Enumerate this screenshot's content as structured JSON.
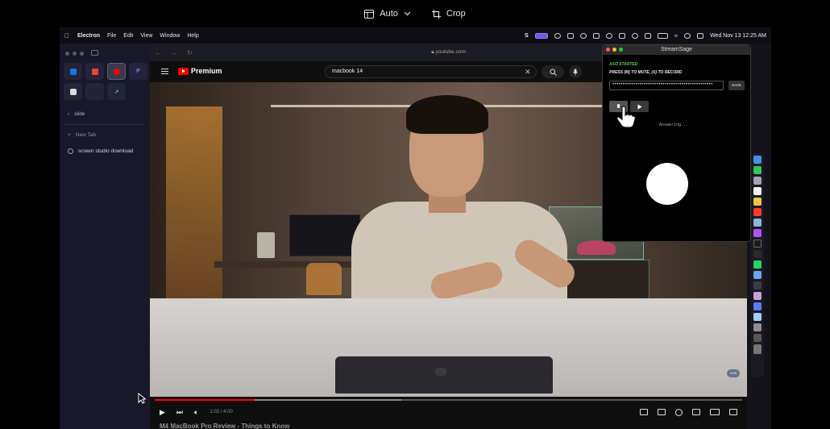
{
  "toolbar": {
    "layout_label": "Auto",
    "crop_label": "Crop"
  },
  "menubar": {
    "app": "Electron",
    "items": [
      "File",
      "Edit",
      "View",
      "Window",
      "Help"
    ],
    "datetime": "Wed Nov 13  12:25 AM"
  },
  "sidebar": {
    "pinned_apps": [
      "outlook",
      "gmail",
      "youtube",
      "perplexity",
      "notion",
      "blank",
      "linear"
    ],
    "folder_label": "slide",
    "new_tab_label": "New Tab",
    "tab_label": "screen studio download"
  },
  "browser": {
    "url": "youtube.com",
    "brand": "Premium",
    "search_value": "macbook 14"
  },
  "player": {
    "timecode": "1:02 / 4:00",
    "progress_fraction": 0.17,
    "buffer_fraction": 0.42,
    "video_title": "M4 MacBook Pro Review - Things to Know",
    "badge": "0:00"
  },
  "streamsage": {
    "title": "StreamSage",
    "status_line": "ASO STARTED",
    "instructions": "PRESS (M) TO MUTE, (X) TO RECORD",
    "key_value": "••••••••••••••••••••••••••••••••••••••••••••••••",
    "save_label": "SAVE",
    "answering": "Answering..."
  },
  "colors": {
    "accent_selected": "#6b5be0",
    "youtube_red": "#ff0000",
    "status_green": "#58d13f"
  }
}
